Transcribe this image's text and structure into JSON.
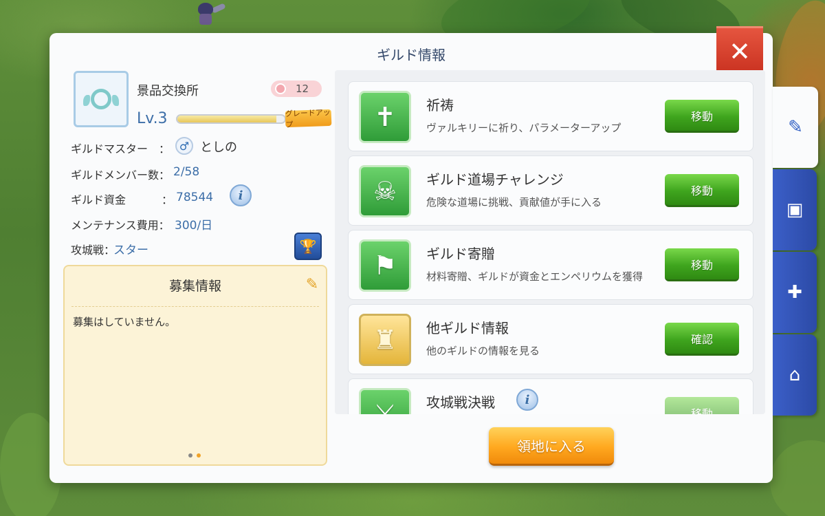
{
  "title": "ギルド情報",
  "close_icon": "close-x-icon",
  "guild": {
    "name": "景品交換所",
    "member_badge": "12",
    "level": "Lv.3",
    "level_progress": 0.92,
    "grade_up_label": "グレードアップ",
    "master_label": "ギルドマスター",
    "master_sep": "：",
    "master_name": "としの",
    "members_label": "ギルドメンバー数：",
    "members_value": "2/58",
    "funds_label": "ギルド資金",
    "funds_sep": "：",
    "funds_value": "78544",
    "maintenance_label": "メンテナンス費用：",
    "maintenance_value": "300/日",
    "siege_label": "攻城戦：",
    "siege_value": "スター"
  },
  "recruit": {
    "title": "募集情報",
    "text": "募集はしていません。",
    "page_count": 2,
    "current_page": 2
  },
  "list": [
    {
      "title": "祈祷",
      "desc": "ヴァルキリーに祈り、パラメーターアップ",
      "button": "移動",
      "icon": "prayer-icon"
    },
    {
      "title": "ギルド道場チャレンジ",
      "desc": "危険な道場に挑戦、貢献値が手に入る",
      "button": "移動",
      "icon": "skull-icon"
    },
    {
      "title": "ギルド寄贈",
      "desc": "材料寄贈、ギルドが資金とエンペリウムを獲得",
      "button": "移動",
      "icon": "donate-icon"
    },
    {
      "title": "他ギルド情報",
      "desc": "他のギルドの情報を見る",
      "button": "確認",
      "icon": "castle-icon"
    },
    {
      "title": "攻城戦決戦",
      "desc": "",
      "button": "移動",
      "icon": "crossed-swords-icon"
    }
  ],
  "enter_button": "領地に入る",
  "side_tabs": [
    "edit-icon",
    "contacts-icon",
    "guild-book-icon",
    "home-user-icon"
  ],
  "colors": {
    "accent_blue": "#3b5fc8",
    "action_green": "#3fa51e",
    "enter_orange": "#ffa81f",
    "close_red": "#c62d1c"
  }
}
